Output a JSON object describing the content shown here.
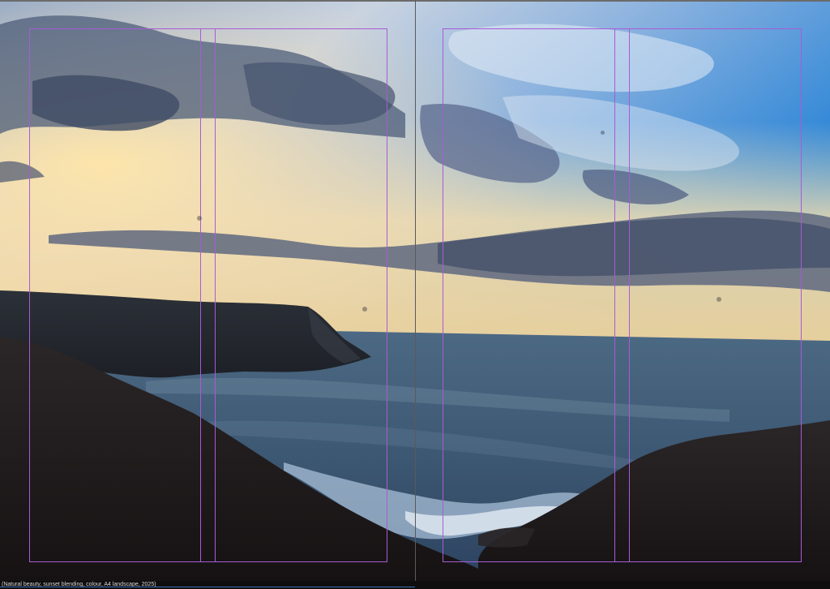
{
  "canvas": {
    "caption": "(Natural beauty, sunset blending, colour, A4 landscape, 2025)"
  },
  "scene": {
    "subject": "coastal cliffs at sunset",
    "colors": {
      "sky_top_right": "#1f7fd6",
      "sky_horizon": "#f3d9a2",
      "cloud": "#5b6a86",
      "sea": "#3f5873",
      "cliff": "#1f1c1c",
      "guide": "#a85bd6"
    }
  }
}
